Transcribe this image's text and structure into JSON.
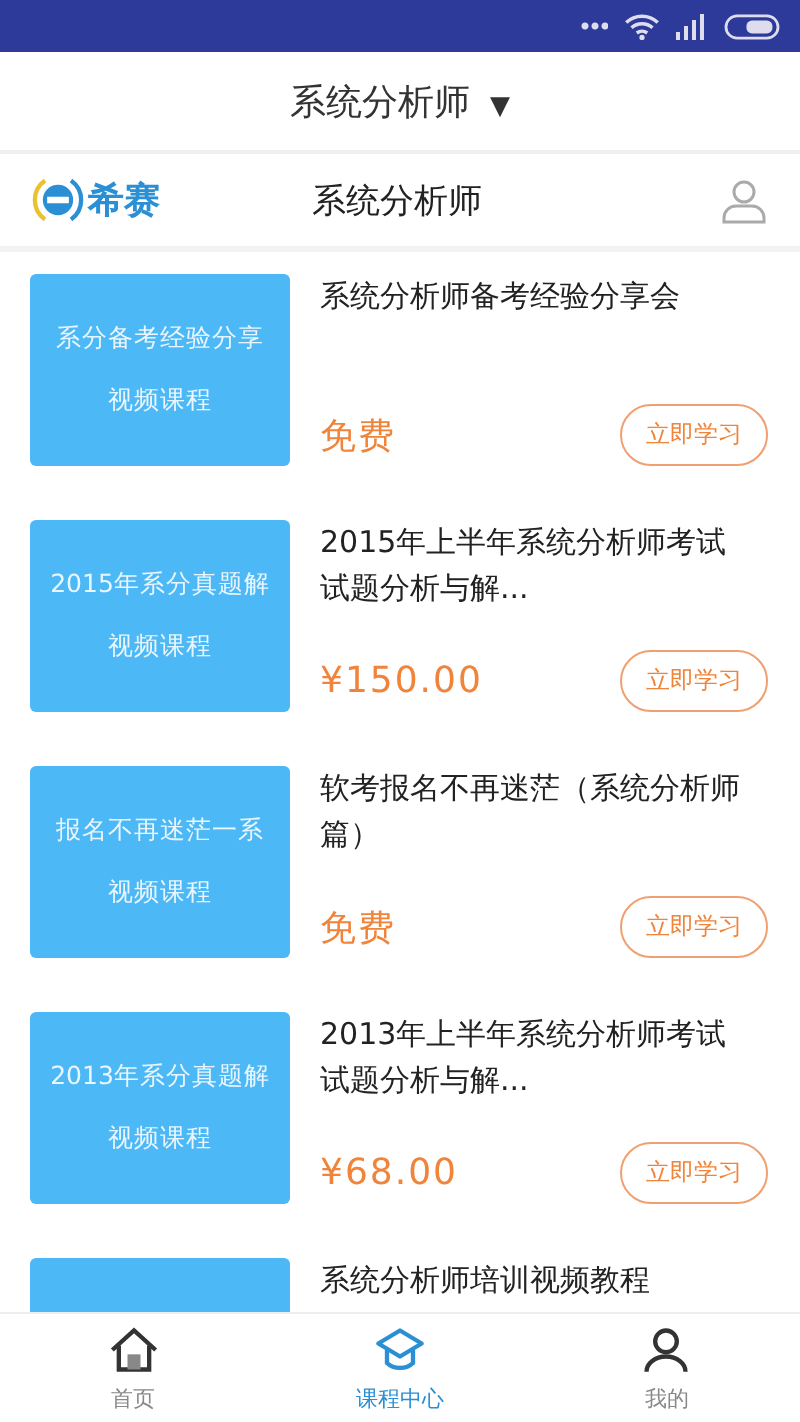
{
  "title_bar": {
    "title": "系统分析师",
    "dropdown_icon": "▼"
  },
  "header": {
    "logo_text": "希赛",
    "title": "系统分析师"
  },
  "courses": [
    {
      "thumb_title": "系分备考经验分享",
      "thumb_subtitle": "视频课程",
      "title": "系统分析师备考经验分享会",
      "price": "免费",
      "button": "立即学习"
    },
    {
      "thumb_title": "2015年系分真题解",
      "thumb_subtitle": "视频课程",
      "title": "2015年上半年系统分析师考试试题分析与解...",
      "price": "¥150.00",
      "button": "立即学习"
    },
    {
      "thumb_title": "报名不再迷茫一系",
      "thumb_subtitle": "视频课程",
      "title": "软考报名不再迷茫（系统分析师篇）",
      "price": "免费",
      "button": "立即学习"
    },
    {
      "thumb_title": "2013年系分真题解",
      "thumb_subtitle": "视频课程",
      "title": "2013年上半年系统分析师考试试题分析与解...",
      "price": "¥68.00",
      "button": "立即学习"
    },
    {
      "title": "系统分析师培训视频教程"
    }
  ],
  "tabs": [
    {
      "label": "首页",
      "kind": "home",
      "selected": false
    },
    {
      "label": "课程中心",
      "kind": "cap",
      "selected": true
    },
    {
      "label": "我的",
      "kind": "user",
      "selected": false
    }
  ]
}
